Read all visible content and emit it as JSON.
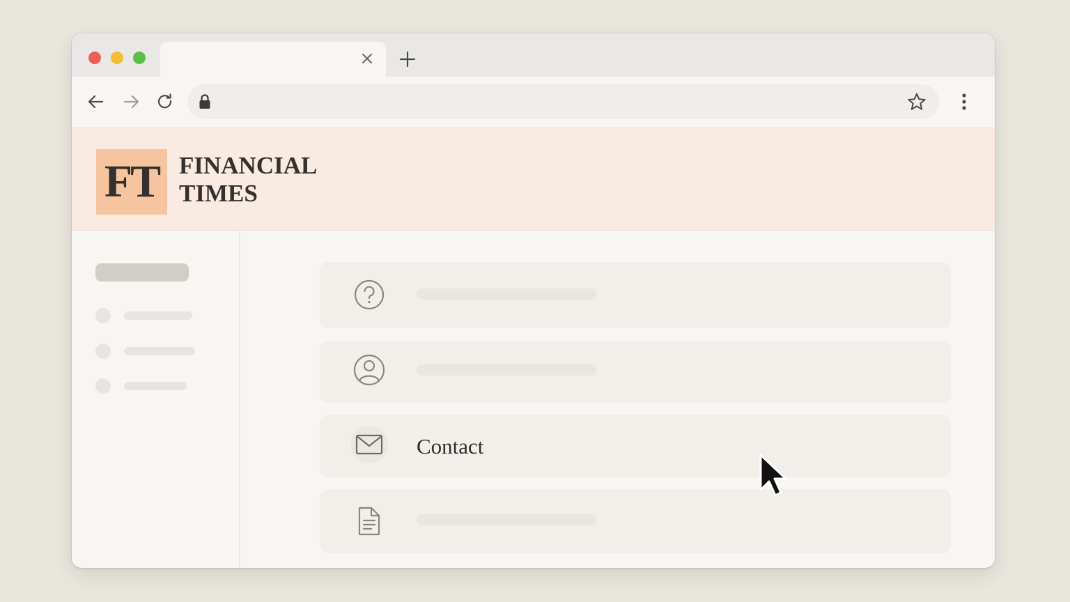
{
  "browser": {
    "tab": {
      "title": "",
      "close_icon": "close-icon"
    },
    "new_tab_icon": "plus-icon",
    "nav": {
      "back_icon": "arrow-left-icon",
      "forward_icon": "arrow-right-icon",
      "reload_icon": "reload-icon"
    },
    "address_bar": {
      "url": "",
      "lock_icon": "lock-icon",
      "bookmark_icon": "star-icon"
    },
    "menu_icon": "kebab-menu-icon"
  },
  "site": {
    "logo_monogram": "FT",
    "brand_line1": "FINANCIAL",
    "brand_line2": "TIMES",
    "header_background": "#f9ebe1",
    "logo_background": "#f6c5a0"
  },
  "menu": {
    "items": [
      {
        "icon": "help-circle-icon",
        "label": ""
      },
      {
        "icon": "user-circle-icon",
        "label": ""
      },
      {
        "icon": "mail-icon",
        "label": "Contact",
        "hovered": true
      },
      {
        "icon": "document-icon",
        "label": ""
      }
    ]
  },
  "traffic_lights": {
    "close": "#ec5f56",
    "minimize": "#f5bd33",
    "maximize": "#5cbf4c"
  }
}
